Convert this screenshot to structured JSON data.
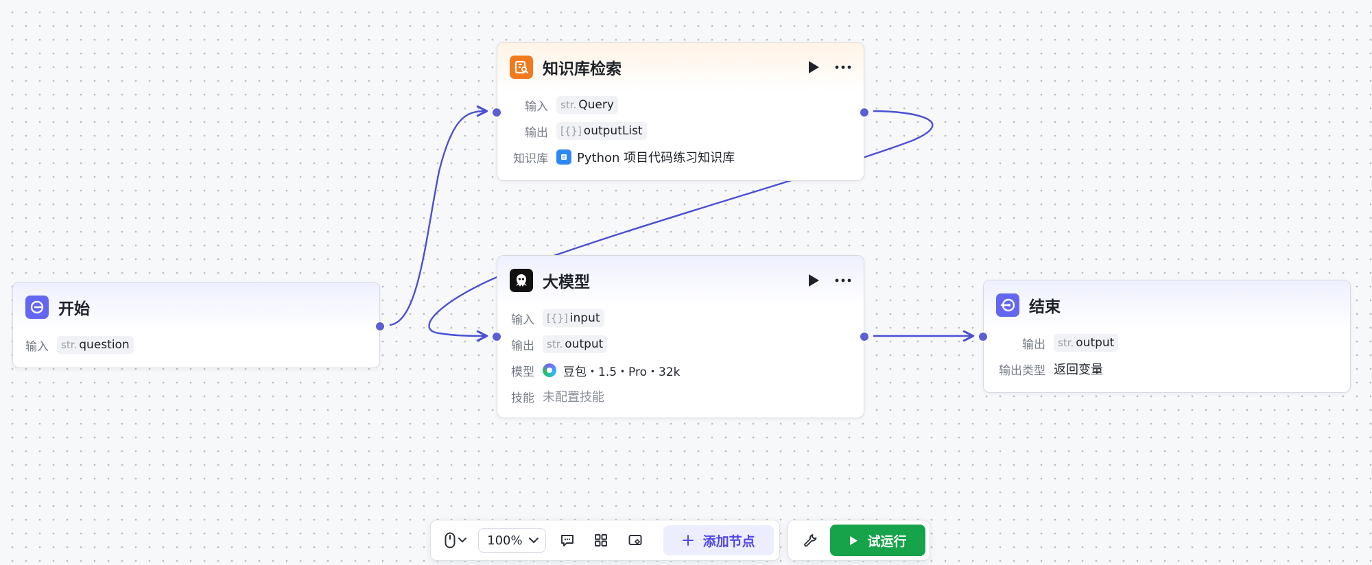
{
  "nodes": {
    "start": {
      "title": "开始",
      "input_label": "输入",
      "input_type": "str.",
      "input_name": "question"
    },
    "kb": {
      "title": "知识库检索",
      "input_label": "输入",
      "input_type": "str.",
      "input_name": "Query",
      "output_label": "输出",
      "output_type": "[{}]",
      "output_name": "outputList",
      "kb_label": "知识库",
      "kb_name": "Python 项目代码练习知识库"
    },
    "llm": {
      "title": "大模型",
      "input_label": "输入",
      "input_type": "[{}]",
      "input_name": "input",
      "output_label": "输出",
      "output_type": "str.",
      "output_name": "output",
      "model_label": "模型",
      "model_name": "豆包・1.5・Pro・32k",
      "skill_label": "技能",
      "skill_value": "未配置技能"
    },
    "end": {
      "title": "结束",
      "output_label": "输出",
      "output_type": "str.",
      "output_name": "output",
      "output_kind_label": "输出类型",
      "output_kind_value": "返回变量"
    }
  },
  "toolbar": {
    "zoom_value": "100%",
    "add_node_label": "添加节点",
    "run_label": "试运行"
  },
  "colors": {
    "edge": "#4b4fd4",
    "accent": "#6366f1",
    "kb_icon": "#f07a1d",
    "run": "#16a34a"
  },
  "icons": {
    "start": "start-circle-icon",
    "kb": "knowledge-search-icon",
    "llm": "llm-octopus-icon",
    "end": "end-circle-icon"
  }
}
